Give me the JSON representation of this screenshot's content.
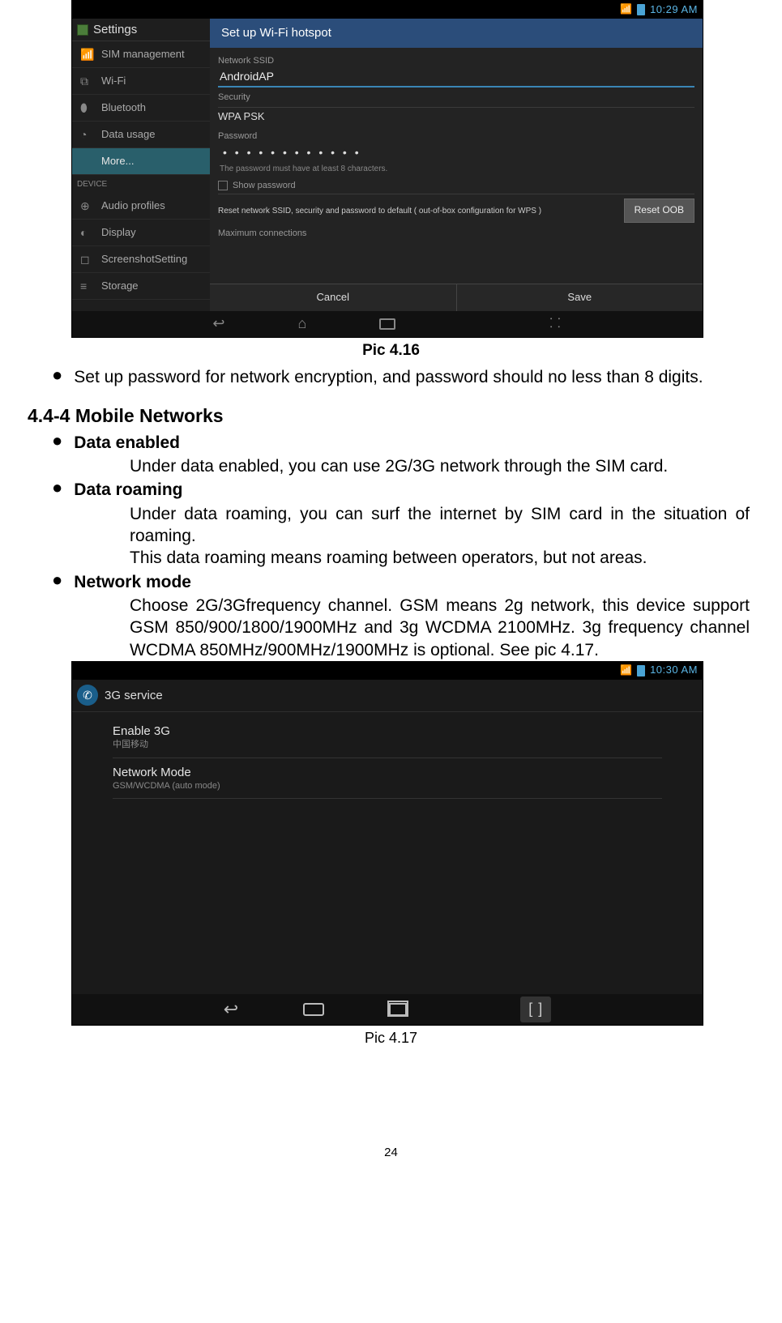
{
  "shot1": {
    "status_time": "10:29 AM",
    "settings_title": "Settings",
    "sidebar": {
      "items": [
        {
          "label": "SIM management",
          "icon": "📶"
        },
        {
          "label": "Wi-Fi",
          "icon": "⧉"
        },
        {
          "label": "Bluetooth",
          "icon": "⬮"
        },
        {
          "label": "Data usage",
          "icon": "◔"
        },
        {
          "label": "More...",
          "icon": ""
        },
        {
          "label": "Audio profiles",
          "icon": "⊕"
        },
        {
          "label": "Display",
          "icon": "◐"
        },
        {
          "label": "ScreenshotSetting",
          "icon": "◻"
        },
        {
          "label": "Storage",
          "icon": "≡"
        }
      ],
      "section_device": "DEVICE"
    },
    "dialog": {
      "title": "Set up Wi-Fi hotspot",
      "ssid_label": "Network SSID",
      "ssid_value": "AndroidAP",
      "security_label": "Security",
      "security_value": "WPA PSK",
      "password_label": "Password",
      "password_value": "• • • • • • • • • • • •",
      "password_hint": "The password must have at least 8 characters.",
      "show_password": "Show password",
      "reset_text": "Reset network SSID, security and password to default ( out-of-box configuration for WPS )",
      "reset_btn": "Reset OOB",
      "max_conn_label": "Maximum connections",
      "cancel": "Cancel",
      "save": "Save"
    }
  },
  "caption1": "Pic 4.16",
  "bullet1": "Set up password for network encryption, and password should no less than 8 digits.",
  "section_h": "4.4-4 Mobile Networks",
  "de_h": "Data enabled",
  "de_t": "Under data enabled, you can use 2G/3G network through the SIM card.",
  "dr_h": "Data roaming",
  "dr_t1": "Under data roaming, you can surf the internet by SIM card in the situation of roaming.",
  "dr_t2": "This data roaming means roaming between operators, but not areas.",
  "nm_h": "Network mode",
  "nm_t": "Choose 2G/3Gfrequency channel. GSM means 2g network, this device support GSM 850/900/1800/1900MHz and 3g WCDMA 2100MHz. 3g frequency channel WCDMA 850MHz/900MHz/1900MHz is optional. See pic 4.17.",
  "shot2": {
    "status_time": "10:30 AM",
    "title": "3G service",
    "items": [
      {
        "t1": "Enable 3G",
        "t2": "中国移动"
      },
      {
        "t1": "Network Mode",
        "t2": "GSM/WCDMA (auto mode)"
      }
    ],
    "bracket": "[ ]"
  },
  "caption2": "Pic 4.17",
  "page_num": "24"
}
